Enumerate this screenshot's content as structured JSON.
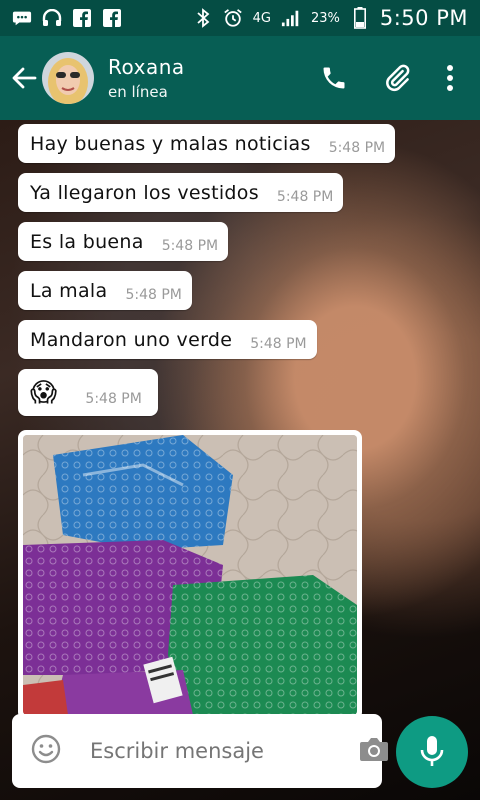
{
  "status_bar": {
    "network": "4G",
    "battery": "23%",
    "time": "5:50 PM"
  },
  "header": {
    "contact_name": "Roxana",
    "contact_status": "en línea"
  },
  "messages": [
    {
      "text": "Hay buenas y malas noticias",
      "time": "5:48 PM"
    },
    {
      "text": "Ya llegaron los vestidos",
      "time": "5:48 PM"
    },
    {
      "text": "Es la buena",
      "time": "5:48 PM"
    },
    {
      "text": "La mala",
      "time": "5:48 PM"
    },
    {
      "text": "Mandaron uno verde",
      "time": "5:48 PM"
    },
    {
      "text": "😱",
      "time": "5:48 PM"
    }
  ],
  "composer": {
    "placeholder": "Escribir mensaje"
  },
  "colors": {
    "header": "#075e54",
    "status_bar": "#054d44",
    "accent": "#0e9b83"
  }
}
